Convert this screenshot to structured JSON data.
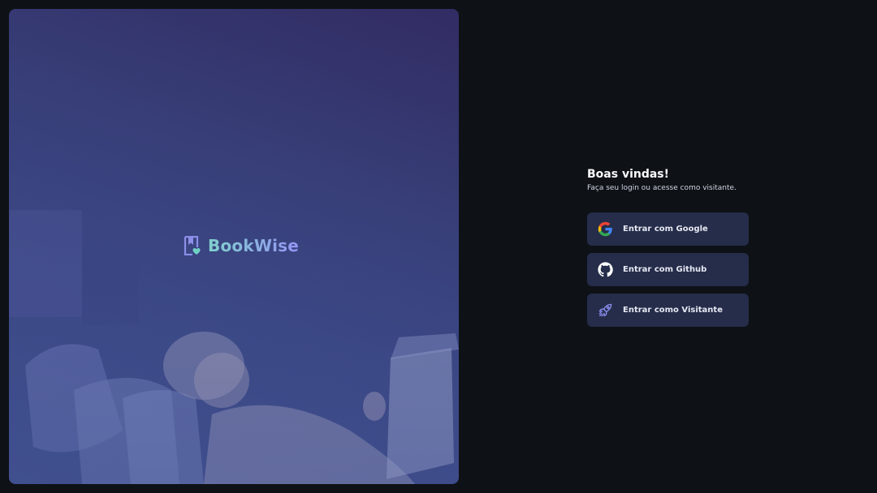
{
  "brand": {
    "name": "BookWise",
    "logo_icon": "book-heart-icon"
  },
  "welcome": {
    "title": "Boas vindas!",
    "subtitle": "Faça seu login ou acesse como visitante."
  },
  "login_options": [
    {
      "label": "Entrar com Google",
      "icon": "google-icon"
    },
    {
      "label": "Entrar com Github",
      "icon": "github-icon"
    },
    {
      "label": "Entrar como Visitante",
      "icon": "rocket-icon"
    }
  ],
  "colors": {
    "background": "#0e1116",
    "button_bg": "#252d4a",
    "brand_gradient_start": "#7fd1cc",
    "brand_gradient_end": "#9694f5",
    "hero_overlay": "#38407a"
  }
}
